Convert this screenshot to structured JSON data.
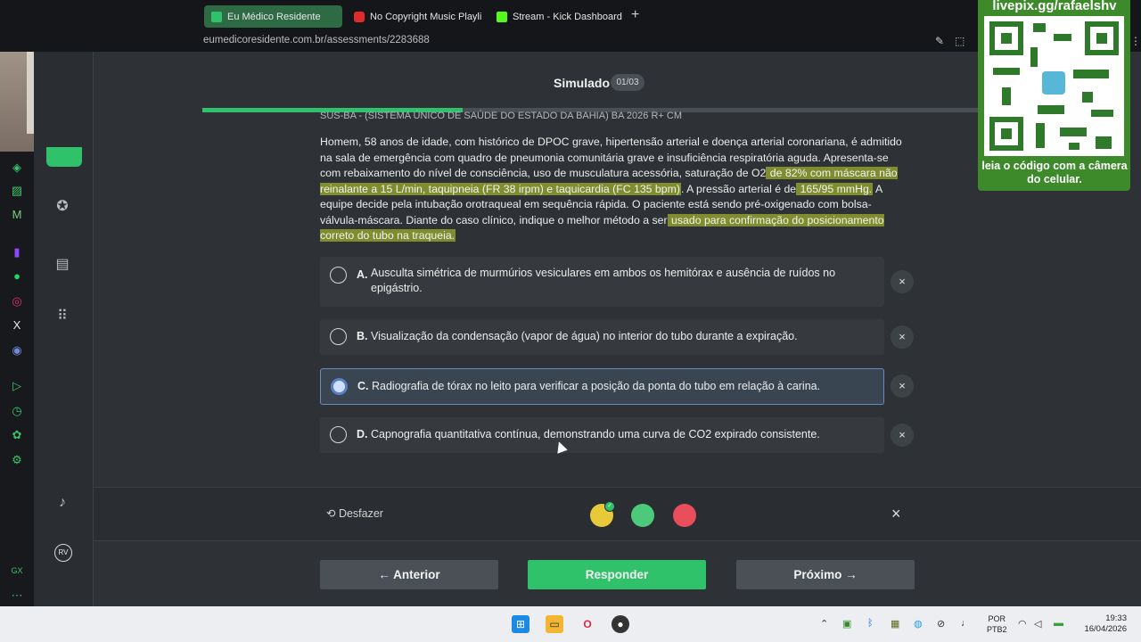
{
  "browser": {
    "tabs": [
      {
        "label": "Eu Médico Residente",
        "active": true,
        "icon": "eumedico-favicon"
      },
      {
        "label": "No Copyright Music Playlis",
        "active": false,
        "icon": "youtube-favicon"
      },
      {
        "label": "Stream - Kick Dashboard",
        "active": false,
        "icon": "kick-favicon"
      }
    ],
    "new_tab": "+",
    "url": "eumedicoresidente.com.br/assessments/2283688"
  },
  "header": {
    "title": "Simulado",
    "badge": "01/03",
    "progress": 0.335
  },
  "question": {
    "source": "SUS-BA - (SISTEMA ÚNICO DE SAÚDE DO ESTADO DA BAHIA) BA 2026 R+ CM",
    "parts": [
      {
        "text": "Homem, 58 anos de idade, com histórico de DPOC grave, hipertensão arterial e doença arterial coronariana, é admitido na sala de emergência com quadro de pneumonia comunitária grave e insuficiência respiratória aguda. Apresenta-se com rebaixamento do nível de consciência, uso de musculatura acessória, saturação de O2",
        "highlight": false
      },
      {
        "text": " de 82% com máscara não reinalante a 15 L/min, taquipneia (FR 38 irpm) e taquicardia (FC 135 bpm)",
        "highlight": true
      },
      {
        "text": ". A pressão arterial é de",
        "highlight": false
      },
      {
        "text": " 165/95 mmHg.",
        "highlight": true
      },
      {
        "text": " A equipe decide pela intubação orotraqueal em sequência rápida. O paciente está sendo pré-oxigenado com bolsa-válvula-máscara. Diante do caso clínico, indique o melhor método a ser",
        "highlight": false
      },
      {
        "text": " usado para confirmação do posicionamento correto do tubo na traqueia.",
        "highlight": true
      }
    ]
  },
  "options": [
    {
      "letter": "A.",
      "text": "Ausculta simétrica de murmúrios vesiculares em ambos os hemitórax e ausência de ruídos no epigástrio.",
      "selected": false
    },
    {
      "letter": "B.",
      "text": "Visualização da condensação (vapor de água) no interior do tubo durante a expiração.",
      "selected": false
    },
    {
      "letter": "C.",
      "text": "Radiografia de tórax no leito para verificar a posição da ponta do tubo em relação à carina.",
      "selected": true
    },
    {
      "letter": "D.",
      "text": "Capnografia quantitativa contínua, demonstrando uma curva de CO2 expirado consistente.",
      "selected": false
    }
  ],
  "option_strike_glyph": "×",
  "toolbar": {
    "undo_label": "Desfazer",
    "colors": [
      "#e8c93a",
      "#4cc97a",
      "#e84f5b"
    ],
    "close_glyph": "×"
  },
  "nav_buttons": {
    "previous": "←  Anterior",
    "answer": "Responder",
    "next": "Próximo  →"
  },
  "sidebar": {
    "avatar": "RV",
    "gx_label": "GX"
  },
  "overlay": {
    "qr_title": "livepix.gg/rafaelshv",
    "qr_caption": "leia o código com a câmera do celular."
  },
  "taskbar": {
    "lang": "POR",
    "lang2": "PTB2",
    "time": "19:33",
    "date": "16/04/2026"
  }
}
